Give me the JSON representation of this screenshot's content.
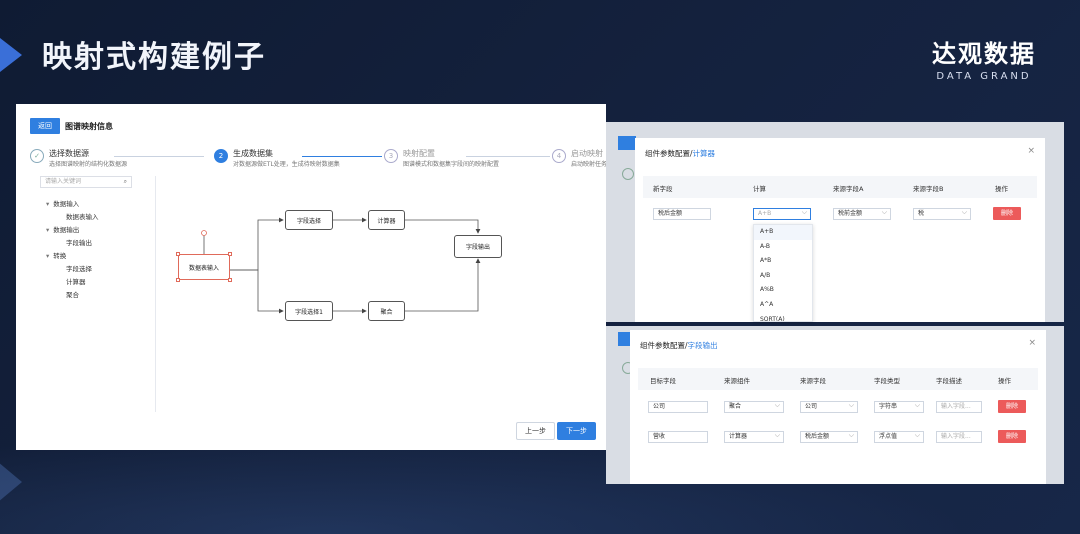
{
  "slide": {
    "title": "映射式构建例子",
    "brand_cn": "达观数据",
    "brand_en": "DATA GRAND"
  },
  "main_panel": {
    "back_label": "返回",
    "title": "图谱映射信息",
    "steps": [
      {
        "number": "✓",
        "label": "选择数据源",
        "desc": "选择图谱映射的结构化数据源",
        "state": "done"
      },
      {
        "number": "2",
        "label": "生成数据集",
        "desc": "对数据源做ETL处理，生成待映射数据集",
        "state": "active"
      },
      {
        "number": "3",
        "label": "映射配置",
        "desc": "图谱模式和数据集字段间的映射配置",
        "state": "pending"
      },
      {
        "number": "4",
        "label": "启动映射",
        "desc": "启动映射任务",
        "state": "pending"
      }
    ],
    "search_placeholder": "请输入关键词",
    "tree": [
      {
        "label": "数据输入",
        "level": 1
      },
      {
        "label": "数据表输入",
        "level": 2
      },
      {
        "label": "数据输出",
        "level": 1
      },
      {
        "label": "字段输出",
        "level": 2
      },
      {
        "label": "转换",
        "level": 1
      },
      {
        "label": "字段选择",
        "level": 2
      },
      {
        "label": "计算器",
        "level": 2
      },
      {
        "label": "聚合",
        "level": 2
      }
    ],
    "flow_nodes": {
      "table_input": "数据表输入",
      "field_select": "字段选择",
      "calculator": "计算器",
      "field_output": "字段输出",
      "field_select_1": "字段选择1",
      "aggregate": "聚合"
    },
    "prev_label": "上一步",
    "next_label": "下一步"
  },
  "dialog_calc": {
    "title_prefix": "组件参数配置/",
    "title_highlight": "计算器",
    "close": "×",
    "headers": [
      "新字段",
      "计算",
      "来源字段A",
      "来源字段B",
      "操作"
    ],
    "row": {
      "new_field": "税后金额",
      "calc_placeholder": "A+B",
      "source_a": "税前金额",
      "source_b": "税",
      "delete": "删除"
    },
    "options": [
      "A+B",
      "A-B",
      "A*B",
      "A/B",
      "A%B",
      "A^A",
      "SQRT(A)"
    ]
  },
  "dialog_output": {
    "title_prefix": "组件参数配置/",
    "title_highlight": "字段输出",
    "close": "×",
    "headers": [
      "目标字段",
      "来源组件",
      "来源字段",
      "字段类型",
      "字段描述",
      "操作"
    ],
    "rows": [
      {
        "target": "公司",
        "component": "聚合",
        "field": "公司",
        "type": "字符串",
        "desc": "输入字段...",
        "delete": "删除"
      },
      {
        "target": "营收",
        "component": "计算器",
        "field": "税后金额",
        "type": "浮点值",
        "desc": "输入字段...",
        "delete": "删除"
      }
    ]
  },
  "colors": {
    "primary": "#2f7fe0",
    "danger": "#ec5a5a",
    "selected_border": "#e06a5a"
  }
}
